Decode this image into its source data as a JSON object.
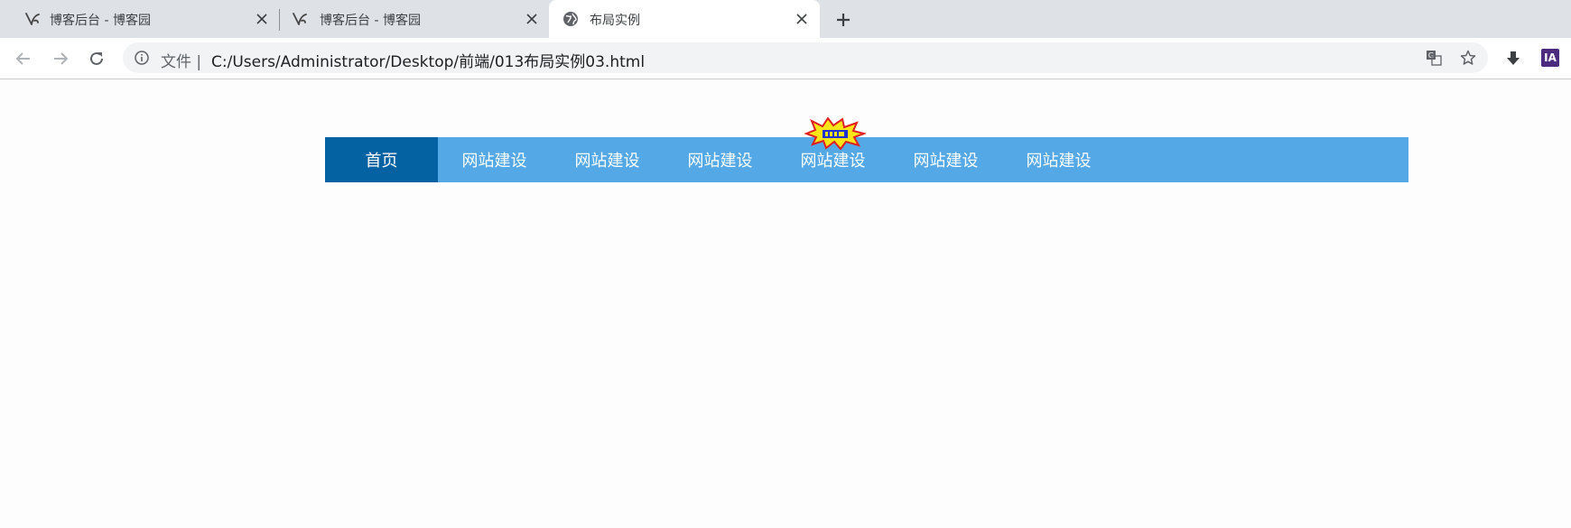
{
  "browser": {
    "tabs": [
      {
        "title": "博客后台 - 博客园",
        "icon": "cnblogs-logo-icon",
        "active": false
      },
      {
        "title": "博客后台 - 博客园",
        "icon": "cnblogs-logo-icon",
        "active": false
      },
      {
        "title": "布局实例",
        "icon": "globe-icon",
        "active": true
      }
    ],
    "new_tab_label": "+",
    "address": {
      "scheme_label": "文件 |",
      "url": "C:/Users/Administrator/Desktop/前端/013布局实例03.html"
    },
    "extension_ia_label": "IA"
  },
  "page": {
    "nav_items": [
      "首页",
      "网站建设",
      "网站建设",
      "网站建设",
      "网站建设",
      "网站建设",
      "网站建设"
    ],
    "current_index": 0,
    "badge_item_index": 4
  },
  "colors": {
    "nav_bg": "#55a8e6",
    "nav_current_bg": "#0461a2",
    "tab_strip_bg": "#dee1e6"
  }
}
